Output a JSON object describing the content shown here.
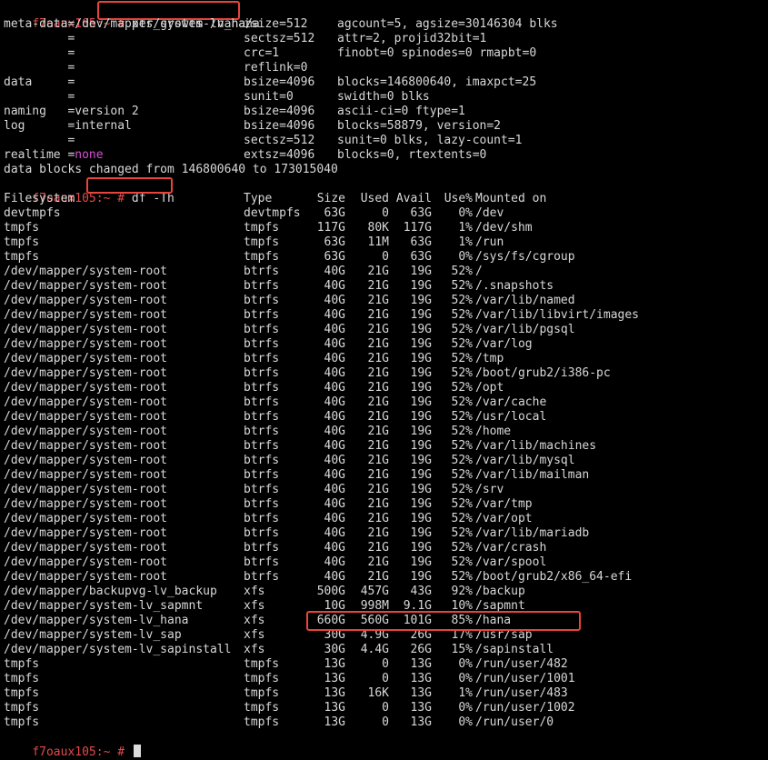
{
  "partial_top": "                                  ",
  "prompt": "f7oaux105:~ # ",
  "cmd_growfs": "xfs_growfs /hana/",
  "growfs_lines": [
    [
      "meta-data=/dev/mapper/system-lv_hana",
      "isize=512",
      "agcount=5, agsize=30146304 blks"
    ],
    [
      "         =",
      "sectsz=512",
      "attr=2, projid32bit=1"
    ],
    [
      "         =",
      "crc=1",
      "finobt=0 spinodes=0 rmapbt=0"
    ],
    [
      "         =",
      "reflink=0",
      ""
    ],
    [
      "data     =",
      "bsize=4096",
      "blocks=146800640, imaxpct=25"
    ],
    [
      "         =",
      "sunit=0",
      "swidth=0 blks"
    ],
    [
      "naming   =version 2",
      "bsize=4096",
      "ascii-ci=0 ftype=1"
    ],
    [
      "log      =internal",
      "bsize=4096",
      "blocks=58879, version=2"
    ],
    [
      "         =",
      "sectsz=512",
      "sunit=0 blks, lazy-count=1"
    ]
  ],
  "realtime_label": "realtime =",
  "realtime_value": "none",
  "realtime_mid": "extsz=4096",
  "realtime_right": "blocks=0, rtextents=0",
  "blocks_changed": "data blocks changed from 146800640 to 173015040",
  "cmd_df": "df -Th",
  "df_header": [
    "Filesystem",
    "Type",
    "Size",
    "Used",
    "Avail",
    "Use%",
    "Mounted on"
  ],
  "df_rows": [
    [
      "devtmpfs",
      "devtmpfs",
      "63G",
      "0",
      "63G",
      "0%",
      "/dev"
    ],
    [
      "tmpfs",
      "tmpfs",
      "117G",
      "80K",
      "117G",
      "1%",
      "/dev/shm"
    ],
    [
      "tmpfs",
      "tmpfs",
      "63G",
      "11M",
      "63G",
      "1%",
      "/run"
    ],
    [
      "tmpfs",
      "tmpfs",
      "63G",
      "0",
      "63G",
      "0%",
      "/sys/fs/cgroup"
    ],
    [
      "/dev/mapper/system-root",
      "btrfs",
      "40G",
      "21G",
      "19G",
      "52%",
      "/"
    ],
    [
      "/dev/mapper/system-root",
      "btrfs",
      "40G",
      "21G",
      "19G",
      "52%",
      "/.snapshots"
    ],
    [
      "/dev/mapper/system-root",
      "btrfs",
      "40G",
      "21G",
      "19G",
      "52%",
      "/var/lib/named"
    ],
    [
      "/dev/mapper/system-root",
      "btrfs",
      "40G",
      "21G",
      "19G",
      "52%",
      "/var/lib/libvirt/images"
    ],
    [
      "/dev/mapper/system-root",
      "btrfs",
      "40G",
      "21G",
      "19G",
      "52%",
      "/var/lib/pgsql"
    ],
    [
      "/dev/mapper/system-root",
      "btrfs",
      "40G",
      "21G",
      "19G",
      "52%",
      "/var/log"
    ],
    [
      "/dev/mapper/system-root",
      "btrfs",
      "40G",
      "21G",
      "19G",
      "52%",
      "/tmp"
    ],
    [
      "/dev/mapper/system-root",
      "btrfs",
      "40G",
      "21G",
      "19G",
      "52%",
      "/boot/grub2/i386-pc"
    ],
    [
      "/dev/mapper/system-root",
      "btrfs",
      "40G",
      "21G",
      "19G",
      "52%",
      "/opt"
    ],
    [
      "/dev/mapper/system-root",
      "btrfs",
      "40G",
      "21G",
      "19G",
      "52%",
      "/var/cache"
    ],
    [
      "/dev/mapper/system-root",
      "btrfs",
      "40G",
      "21G",
      "19G",
      "52%",
      "/usr/local"
    ],
    [
      "/dev/mapper/system-root",
      "btrfs",
      "40G",
      "21G",
      "19G",
      "52%",
      "/home"
    ],
    [
      "/dev/mapper/system-root",
      "btrfs",
      "40G",
      "21G",
      "19G",
      "52%",
      "/var/lib/machines"
    ],
    [
      "/dev/mapper/system-root",
      "btrfs",
      "40G",
      "21G",
      "19G",
      "52%",
      "/var/lib/mysql"
    ],
    [
      "/dev/mapper/system-root",
      "btrfs",
      "40G",
      "21G",
      "19G",
      "52%",
      "/var/lib/mailman"
    ],
    [
      "/dev/mapper/system-root",
      "btrfs",
      "40G",
      "21G",
      "19G",
      "52%",
      "/srv"
    ],
    [
      "/dev/mapper/system-root",
      "btrfs",
      "40G",
      "21G",
      "19G",
      "52%",
      "/var/tmp"
    ],
    [
      "/dev/mapper/system-root",
      "btrfs",
      "40G",
      "21G",
      "19G",
      "52%",
      "/var/opt"
    ],
    [
      "/dev/mapper/system-root",
      "btrfs",
      "40G",
      "21G",
      "19G",
      "52%",
      "/var/lib/mariadb"
    ],
    [
      "/dev/mapper/system-root",
      "btrfs",
      "40G",
      "21G",
      "19G",
      "52%",
      "/var/crash"
    ],
    [
      "/dev/mapper/system-root",
      "btrfs",
      "40G",
      "21G",
      "19G",
      "52%",
      "/var/spool"
    ],
    [
      "/dev/mapper/system-root",
      "btrfs",
      "40G",
      "21G",
      "19G",
      "52%",
      "/boot/grub2/x86_64-efi"
    ],
    [
      "/dev/mapper/backupvg-lv_backup",
      "xfs",
      "500G",
      "457G",
      "43G",
      "92%",
      "/backup"
    ],
    [
      "/dev/mapper/system-lv_sapmnt",
      "xfs",
      "10G",
      "998M",
      "9.1G",
      "10%",
      "/sapmnt"
    ],
    [
      "/dev/mapper/system-lv_hana",
      "xfs",
      "660G",
      "560G",
      "101G",
      "85%",
      "/hana"
    ],
    [
      "/dev/mapper/system-lv_sap",
      "xfs",
      "30G",
      "4.9G",
      "26G",
      "17%",
      "/usr/sap"
    ],
    [
      "/dev/mapper/system-lv_sapinstall",
      "xfs",
      "30G",
      "4.4G",
      "26G",
      "15%",
      "/sapinstall"
    ],
    [
      "tmpfs",
      "tmpfs",
      "13G",
      "0",
      "13G",
      "0%",
      "/run/user/482"
    ],
    [
      "tmpfs",
      "tmpfs",
      "13G",
      "0",
      "13G",
      "0%",
      "/run/user/1001"
    ],
    [
      "tmpfs",
      "tmpfs",
      "13G",
      "16K",
      "13G",
      "1%",
      "/run/user/483"
    ],
    [
      "tmpfs",
      "tmpfs",
      "13G",
      "0",
      "13G",
      "0%",
      "/run/user/1002"
    ],
    [
      "tmpfs",
      "tmpfs",
      "13G",
      "0",
      "13G",
      "0%",
      "/run/user/0"
    ]
  ],
  "colors": {
    "prompt": "#e34a4a",
    "highlight": "#e8443b",
    "realtime_none": "#d64fd6",
    "text": "#d8d8d8",
    "background": "#000000"
  }
}
